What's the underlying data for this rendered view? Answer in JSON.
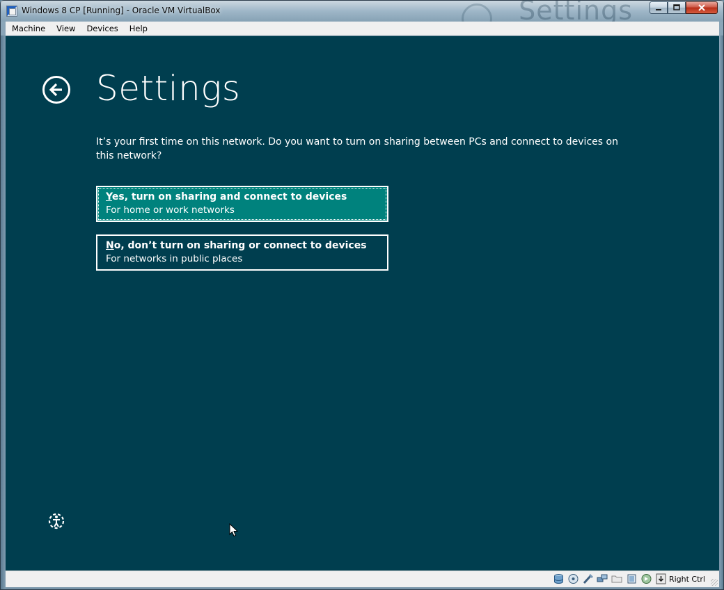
{
  "window": {
    "title": "Windows 8 CP [Running] - Oracle VM VirtualBox",
    "ghost_text": "Settings",
    "controls": {
      "minimize_icon": "minimize-icon",
      "restore_icon": "restore-icon",
      "close_icon": "close-icon"
    }
  },
  "menubar": {
    "items": [
      {
        "label": "Machine"
      },
      {
        "label": "View"
      },
      {
        "label": "Devices"
      },
      {
        "label": "Help"
      }
    ]
  },
  "guest": {
    "background": "#003e4f",
    "page_title": "Settings",
    "prompt": "It’s your first time on this network. Do you want to turn on sharing between PCs and connect to devices on this network?",
    "options": [
      {
        "accel": "Y",
        "label_rest": "es, turn on sharing and connect to devices",
        "sub": "For home or work networks",
        "selected": true,
        "color": "#00827d"
      },
      {
        "accel": "N",
        "label_rest": "o, don’t turn on sharing or connect to devices",
        "sub": "For networks in public places",
        "selected": false
      }
    ],
    "icons": {
      "back": "back-arrow-icon",
      "ease_of_access": "ease-of-access-icon",
      "cursor": "mouse-pointer-icon"
    }
  },
  "statusbar": {
    "icons": [
      "hard-disk-icon",
      "optical-drive-icon",
      "usb-icon",
      "network-icon",
      "shared-folders-icon",
      "display-icon",
      "mouse-integration-icon",
      "keyboard-capture-icon"
    ],
    "host_key": "Right Ctrl"
  }
}
